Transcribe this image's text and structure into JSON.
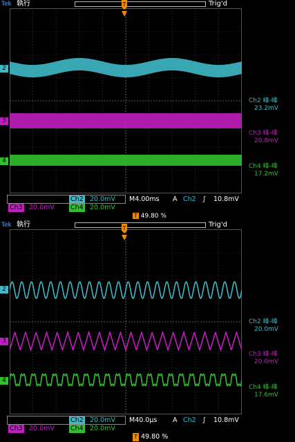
{
  "top": {
    "status": {
      "tek": "Tek",
      "run": "執行",
      "trig": "Trig'd"
    },
    "readouts": [
      {
        "label": "Ch2 峰-峰",
        "value": "23.2mV",
        "color": "#3fb8c8"
      },
      {
        "label": "Ch3 峰-峰",
        "value": "20.8mV",
        "color": "#c01ec0"
      },
      {
        "label": "Ch4 峰-峰",
        "value": "17.2mV",
        "color": "#30c030"
      }
    ],
    "settings": {
      "ch2": "Ch2",
      "ch2_scale": "20.0mV",
      "timebase": "M4.00ms",
      "a": "A",
      "trig_ch": "Ch2",
      "trig_slope": "∫",
      "trig_level": "10.8mV",
      "ch3": "Ch3",
      "ch3_scale": "20.0mV",
      "ch4": "Ch4",
      "ch4_scale": "20.0mV"
    }
  },
  "bottom": {
    "status": {
      "tek": "Tek",
      "run": "執行",
      "trig": "Trig'd",
      "position": "49.80 %"
    },
    "readouts": [
      {
        "label": "Ch2 峰-峰",
        "value": "20.0mV",
        "color": "#3fb8c8"
      },
      {
        "label": "Ch3 峰-峰",
        "value": "20.0mV",
        "color": "#c01ec0"
      },
      {
        "label": "Ch4 峰-峰",
        "value": "17.6mV",
        "color": "#30c030"
      }
    ],
    "settings": {
      "ch2": "Ch2",
      "ch2_scale": "20.0mV",
      "timebase": "M40.0µs",
      "a": "A",
      "trig_ch": "Ch2",
      "trig_slope": "∫",
      "trig_level": "10.8mV",
      "ch3": "Ch3",
      "ch3_scale": "20.0mV",
      "ch4": "Ch4",
      "ch4_scale": "20.0mV",
      "position": "49.80 %"
    }
  },
  "markers": {
    "ch2": "2",
    "ch3": "3",
    "ch4": "4",
    "trigger": "T"
  },
  "colors": {
    "ch2": "#3fb8c8",
    "ch3": "#c01ec0",
    "ch4": "#30c030",
    "grid": "#555555",
    "accent": "#f08a00"
  }
}
